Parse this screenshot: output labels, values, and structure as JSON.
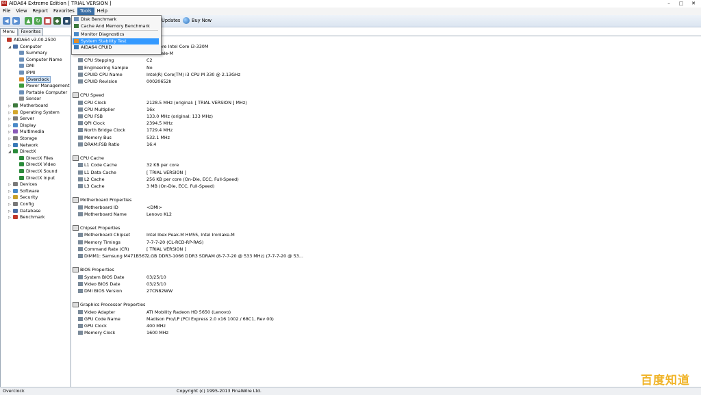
{
  "window": {
    "title": "AIDA64 Extreme Edition  [ TRIAL VERSION ]",
    "min": "–",
    "max": "□",
    "close": "✕"
  },
  "menu": [
    "File",
    "View",
    "Report",
    "Favorites",
    "Tools",
    "Help"
  ],
  "active_menu": "Tools",
  "toolbar": {
    "updates_label": "Updates",
    "buy_label": "Buy Now"
  },
  "tabs": [
    "Menu",
    "Favorites"
  ],
  "tree": [
    {
      "label": "AIDA64 v3.00.2500",
      "level": 0,
      "twisty": "",
      "color": "#c0392b"
    },
    {
      "label": "Computer",
      "level": 1,
      "twisty": "◢",
      "color": "#4a6fa5"
    },
    {
      "label": "Summary",
      "level": 2,
      "twisty": "",
      "color": "#6c8fb8"
    },
    {
      "label": "Computer Name",
      "level": 2,
      "twisty": "",
      "color": "#6c8fb8"
    },
    {
      "label": "DMI",
      "level": 2,
      "twisty": "",
      "color": "#6c8fb8"
    },
    {
      "label": "IPMI",
      "level": 2,
      "twisty": "",
      "color": "#6c8fb8"
    },
    {
      "label": "Overclock",
      "level": 2,
      "twisty": "",
      "color": "#e08b2a",
      "selected": true
    },
    {
      "label": "Power Management",
      "level": 2,
      "twisty": "",
      "color": "#3a9a3a"
    },
    {
      "label": "Portable Computer",
      "level": 2,
      "twisty": "",
      "color": "#6c8fb8"
    },
    {
      "label": "Sensor",
      "level": 2,
      "twisty": "",
      "color": "#8a8a8a"
    },
    {
      "label": "Motherboard",
      "level": 1,
      "twisty": "▷",
      "color": "#3d7a3d"
    },
    {
      "label": "Operating System",
      "level": 1,
      "twisty": "▷",
      "color": "#d4a72c"
    },
    {
      "label": "Server",
      "level": 1,
      "twisty": "▷",
      "color": "#7a7a7a"
    },
    {
      "label": "Display",
      "level": 1,
      "twisty": "▷",
      "color": "#4a8ac8"
    },
    {
      "label": "Multimedia",
      "level": 1,
      "twisty": "▷",
      "color": "#8a5ab8"
    },
    {
      "label": "Storage",
      "level": 1,
      "twisty": "▷",
      "color": "#7a7a7a"
    },
    {
      "label": "Network",
      "level": 1,
      "twisty": "▷",
      "color": "#3a7ab8"
    },
    {
      "label": "DirectX",
      "level": 1,
      "twisty": "◢",
      "color": "#2a8a3a"
    },
    {
      "label": "DirectX Files",
      "level": 2,
      "twisty": "",
      "color": "#2a8a3a"
    },
    {
      "label": "DirectX Video",
      "level": 2,
      "twisty": "",
      "color": "#2a8a3a"
    },
    {
      "label": "DirectX Sound",
      "level": 2,
      "twisty": "",
      "color": "#2a8a3a"
    },
    {
      "label": "DirectX Input",
      "level": 2,
      "twisty": "",
      "color": "#2a8a3a"
    },
    {
      "label": "Devices",
      "level": 1,
      "twisty": "▷",
      "color": "#7a7a7a"
    },
    {
      "label": "Software",
      "level": 1,
      "twisty": "▷",
      "color": "#4a8ac8"
    },
    {
      "label": "Security",
      "level": 1,
      "twisty": "▷",
      "color": "#c8a02a"
    },
    {
      "label": "Config",
      "level": 1,
      "twisty": "▷",
      "color": "#7a7a7a"
    },
    {
      "label": "Database",
      "level": 1,
      "twisty": "▷",
      "color": "#4a6fa5"
    },
    {
      "label": "Benchmark",
      "level": 1,
      "twisty": "▷",
      "color": "#c0392b"
    }
  ],
  "dropdown": [
    {
      "label": "Disk Benchmark",
      "color": "#6c8fb8"
    },
    {
      "label": "Cache And Memory Benchmark",
      "color": "#3d7a3d"
    },
    {
      "sep": true
    },
    {
      "label": "Monitor Diagnostics",
      "color": "#4a8ac8"
    },
    {
      "label": "System Stability Test",
      "color": "#e08b2a",
      "highlight": true
    },
    {
      "label": "AIDA64 CPUID",
      "color": "#3a7ab8"
    }
  ],
  "sections": [
    {
      "title": "",
      "rows": [
        {
          "field": "",
          "value": "DualCore Intel Core i3-330M",
          "partial": true
        },
        {
          "field": "",
          "value": "Arrandale-M",
          "partial": true
        },
        {
          "field": "CPU Stepping",
          "value": "C2"
        },
        {
          "field": "Engineering Sample",
          "value": "No"
        },
        {
          "field": "CPUID CPU Name",
          "value": "Intel(R) Core(TM) i3 CPU M 330 @ 2.13GHz"
        },
        {
          "field": "CPUID Revision",
          "value": "00020652h"
        }
      ]
    },
    {
      "title": "CPU Speed",
      "rows": [
        {
          "field": "CPU Clock",
          "value": "2128.5 MHz  (original: [ TRIAL VERSION ] MHz)"
        },
        {
          "field": "CPU Multiplier",
          "value": "16x"
        },
        {
          "field": "CPU FSB",
          "value": "133.0 MHz  (original: 133 MHz)"
        },
        {
          "field": "QPI Clock",
          "value": "2394.5 MHz"
        },
        {
          "field": "North Bridge Clock",
          "value": "1729.4 MHz"
        },
        {
          "field": "Memory Bus",
          "value": "532.1 MHz"
        },
        {
          "field": "DRAM:FSB Ratio",
          "value": "16:4"
        }
      ]
    },
    {
      "title": "CPU Cache",
      "rows": [
        {
          "field": "L1 Code Cache",
          "value": "32 KB per core"
        },
        {
          "field": "L1 Data Cache",
          "value": "[ TRIAL VERSION ]"
        },
        {
          "field": "L2 Cache",
          "value": "256 KB per core  (On-Die, ECC, Full-Speed)"
        },
        {
          "field": "L3 Cache",
          "value": "3 MB  (On-Die, ECC, Full-Speed)"
        }
      ]
    },
    {
      "title": "Motherboard Properties",
      "rows": [
        {
          "field": "Motherboard ID",
          "value": "<DMI>"
        },
        {
          "field": "Motherboard Name",
          "value": "Lenovo KL2"
        }
      ]
    },
    {
      "title": "Chipset Properties",
      "rows": [
        {
          "field": "Motherboard Chipset",
          "value": "Intel Ibex Peak-M HM55, Intel Ironlake-M"
        },
        {
          "field": "Memory Timings",
          "value": "7-7-7-20  (CL-RCD-RP-RAS)"
        },
        {
          "field": "Command Rate (CR)",
          "value": "[ TRIAL VERSION ]"
        },
        {
          "field": "DIMM1: Samsung M471B567...",
          "value": "2 GB DDR3-1066 DDR3 SDRAM  (8-7-7-20 @ 533 MHz)  (7-7-7-20 @ 53..."
        }
      ]
    },
    {
      "title": "BIOS Properties",
      "rows": [
        {
          "field": "System BIOS Date",
          "value": "03/25/10"
        },
        {
          "field": "Video BIOS Date",
          "value": "03/25/10"
        },
        {
          "field": "DMI BIOS Version",
          "value": "27CN82WW"
        }
      ]
    },
    {
      "title": "Graphics Processor Properties",
      "rows": [
        {
          "field": "Video Adapter",
          "value": "ATI Mobility Radeon HD 5650 (Lenovo)"
        },
        {
          "field": "GPU Code Name",
          "value": "Madison Pro/LP  (PCI Express 2.0 x16 1002 / 68C1, Rev 00)"
        },
        {
          "field": "GPU Clock",
          "value": "400 MHz"
        },
        {
          "field": "Memory Clock",
          "value": "1600 MHz"
        }
      ]
    }
  ],
  "status": {
    "left": "Overclock",
    "center": "Copyright (c) 1995-2013 FinalWire Ltd."
  },
  "watermark": "百度知道"
}
